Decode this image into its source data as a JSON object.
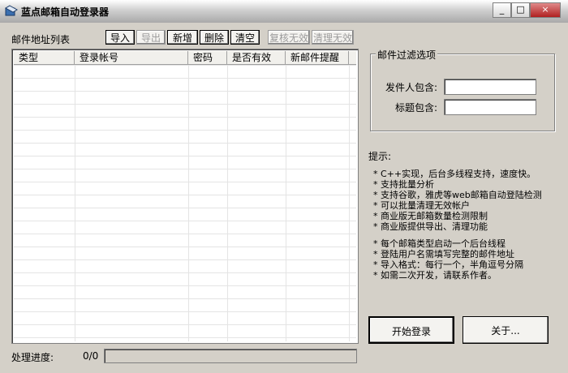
{
  "window": {
    "title": "蓝点邮箱自动登录器",
    "controls": [
      "_",
      "□",
      "×"
    ]
  },
  "toolbar": {
    "list_title": "邮件地址列表",
    "buttons": [
      {
        "label": "导入",
        "enabled": true
      },
      {
        "label": "导出",
        "enabled": false
      },
      {
        "label": "新增",
        "enabled": true
      },
      {
        "label": "删除",
        "enabled": true
      },
      {
        "label": "清空",
        "enabled": true
      },
      {
        "label": "复核无效",
        "enabled": false
      },
      {
        "label": "清理无效",
        "enabled": false
      }
    ]
  },
  "table": {
    "columns": [
      "类型",
      "登录帐号",
      "密码",
      "是否有效",
      "新邮件提醒"
    ]
  },
  "filter": {
    "group_title": "邮件过滤选项",
    "sender_label": "发件人包含:",
    "subject_label": "标题包含:",
    "sender_value": "",
    "subject_value": ""
  },
  "tips": {
    "title": "提示:",
    "lines1": [
      "* C++实现，后台多线程支持，速度快。",
      "* 支持批量分析",
      "* 支持谷歌，雅虎等web邮箱自动登陆检测",
      "* 可以批量清理无效帐户",
      "* 商业版无邮箱数量检测限制",
      "* 商业版提供导出、清理功能"
    ],
    "lines2": [
      "* 每个邮箱类型启动一个后台线程",
      "* 登陆用户名需填写完整的邮件地址",
      "* 导入格式：每行一个，半角逗号分隔",
      "* 如需二次开发，请联系作者。"
    ]
  },
  "status": {
    "progress_label": "处理进度:",
    "progress_count": "0/0",
    "progress_fraction": 0
  },
  "actions": {
    "start_label": "开始登录",
    "about_label": "关于..."
  },
  "colors": {
    "chrome": "#d4d0c8",
    "list_bg": "#ffffff"
  }
}
